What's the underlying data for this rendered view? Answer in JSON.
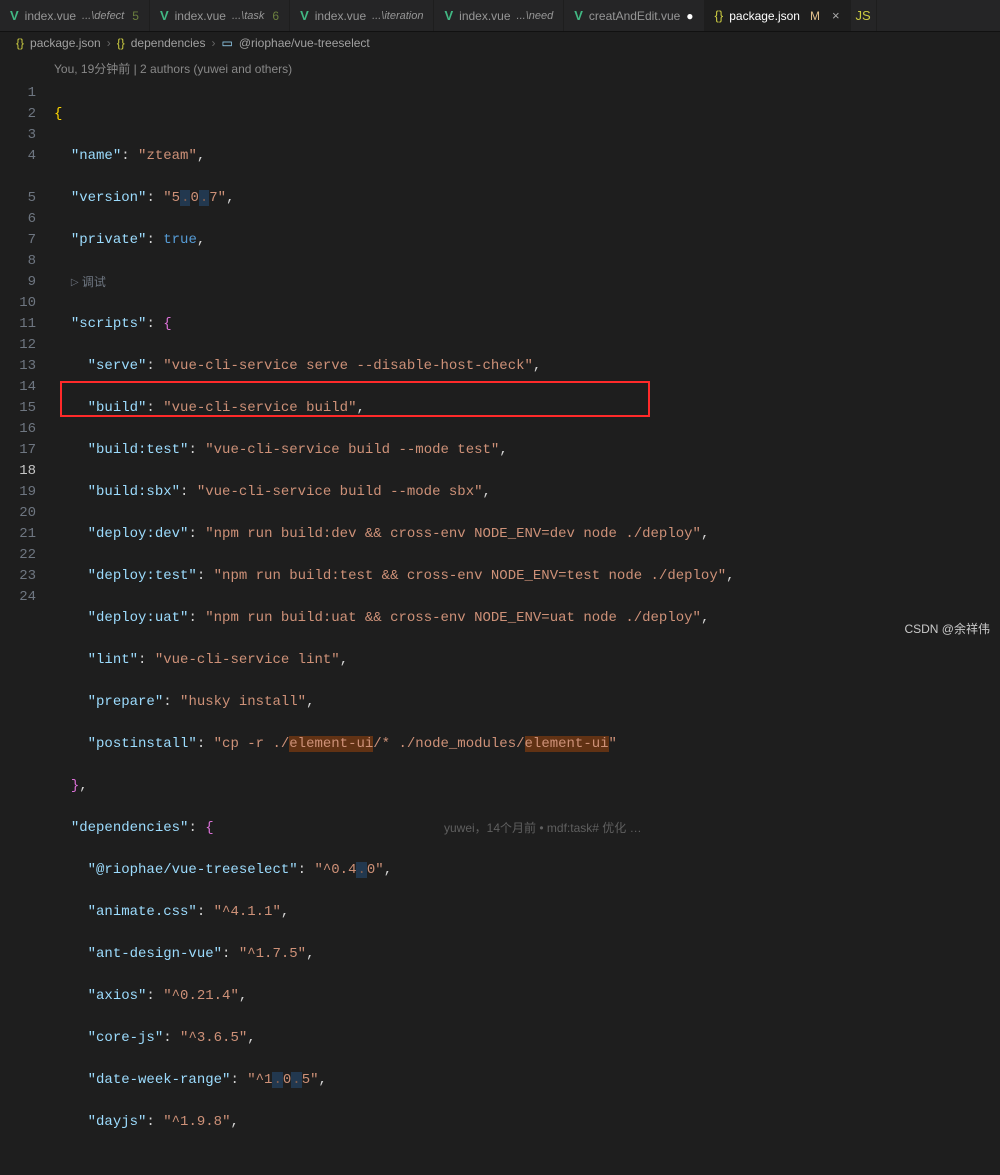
{
  "tabs": [
    {
      "icon": "vue",
      "label": "index.vue",
      "path": "...\\defect",
      "badge": "5",
      "m": "",
      "dot": false
    },
    {
      "icon": "vue",
      "label": "index.vue",
      "path": "...\\task",
      "badge": "6",
      "m": "",
      "dot": false
    },
    {
      "icon": "vue",
      "label": "index.vue",
      "path": "...\\iteration",
      "badge": "",
      "m": "",
      "dot": false
    },
    {
      "icon": "vue",
      "label": "index.vue",
      "path": "...\\need",
      "badge": "",
      "m": "",
      "dot": false
    },
    {
      "icon": "vue",
      "label": "creatAndEdit.vue",
      "path": "",
      "badge": "",
      "m": "",
      "dot": true
    },
    {
      "icon": "json",
      "label": "package.json",
      "path": "",
      "badge": "",
      "m": "M",
      "dot": false,
      "active": true,
      "close": "×"
    }
  ],
  "breadcrumb": {
    "seg1": "package.json",
    "seg2": "dependencies",
    "seg3": "@riophae/vue-treeselect"
  },
  "blame_top": "You, 19分钟前 | 2 authors (yuwei and others)",
  "debug_label": "调试",
  "inline_blame": "yuwei，14个月前 • mdf:task# 优化 …",
  "lines": [
    1,
    2,
    3,
    4,
    "",
    5,
    6,
    7,
    8,
    9,
    10,
    11,
    12,
    13,
    14,
    15,
    16,
    17,
    18,
    19,
    20,
    21,
    22,
    23,
    24
  ],
  "json": {
    "name": "zteam",
    "version": "5.0.7",
    "private": "true",
    "scripts": {
      "serve": "vue-cli-service serve --disable-host-check",
      "build": "vue-cli-service build",
      "build:test": "vue-cli-service build --mode test",
      "build:sbx": "vue-cli-service build --mode sbx",
      "deploy:dev": "npm run build:dev && cross-env NODE_ENV=dev node ./deploy",
      "deploy:test": "npm run build:test && cross-env NODE_ENV=test node ./deploy",
      "deploy:uat": "npm run build:uat && cross-env NODE_ENV=uat node ./deploy",
      "lint": "vue-cli-service lint",
      "prepare": "husky install",
      "postinstall": "cp -r ./element-ui/* ./node_modules/element-ui"
    },
    "dependencies": {
      "@riophae/vue-treeselect": "^0.4.0",
      "animate.css": "^4.1.1",
      "ant-design-vue": "^1.7.5",
      "axios": "^0.21.4",
      "core-js": "^3.6.5",
      "date-week-range": "^1.0.5",
      "dayjs": "^1.9.8"
    }
  },
  "watermark": "CSDN @余祥伟"
}
